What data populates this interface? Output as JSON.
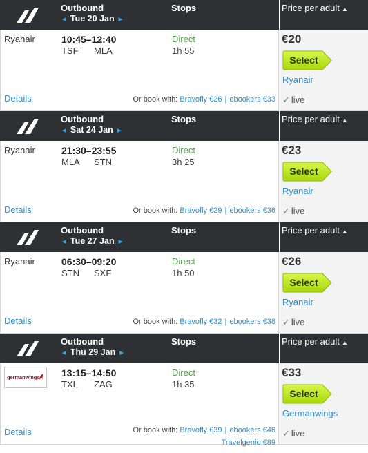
{
  "labels": {
    "outbound": "Outbound",
    "stops": "Stops",
    "price_per_adult": "Price per adult",
    "sort_arrow": "▲",
    "prev_arrow": "◄",
    "next_arrow": "►",
    "select": "Select",
    "details": "Details",
    "or_book_with": "Or book with:",
    "live": "live",
    "check": "✓",
    "separator": "|"
  },
  "colors": {
    "header_bg": "#2f3034",
    "link": "#2f8fc4",
    "direct_green": "#52a04a",
    "select_button": "#c6f01a"
  },
  "flights": [
    {
      "date": "Tue 20 Jan",
      "airline": "Ryanair",
      "airline_logo": false,
      "depart_time": "10:45",
      "arrive_time": "12:40",
      "origin": "TSF",
      "destination": "MLA",
      "stops": "Direct",
      "duration": "1h 55",
      "price": "€20",
      "provider": "Ryanair",
      "alt_line1": [
        "Bravofly €26",
        "ebookers €33"
      ],
      "alt_line2": ""
    },
    {
      "date": "Sat 24 Jan",
      "airline": "Ryanair",
      "airline_logo": false,
      "depart_time": "21:30",
      "arrive_time": "23:55",
      "origin": "MLA",
      "destination": "STN",
      "stops": "Direct",
      "duration": "3h 25",
      "price": "€23",
      "provider": "Ryanair",
      "alt_line1": [
        "Bravofly €29",
        "ebookers €36"
      ],
      "alt_line2": ""
    },
    {
      "date": "Tue 27 Jan",
      "airline": "Ryanair",
      "airline_logo": false,
      "depart_time": "06:30",
      "arrive_time": "09:20",
      "origin": "STN",
      "destination": "SXF",
      "stops": "Direct",
      "duration": "1h 50",
      "price": "€26",
      "provider": "Ryanair",
      "alt_line1": [
        "Bravofly €32",
        "ebookers €38"
      ],
      "alt_line2": ""
    },
    {
      "date": "Thu 29 Jan",
      "airline": "germanwings",
      "airline_logo": true,
      "depart_time": "13:15",
      "arrive_time": "14:50",
      "origin": "TXL",
      "destination": "ZAG",
      "stops": "Direct",
      "duration": "1h 35",
      "price": "€33",
      "provider": "Germanwings",
      "alt_line1": [
        "Bravofly €39",
        "ebookers €46"
      ],
      "alt_line2": "Travelgenio €89"
    }
  ]
}
